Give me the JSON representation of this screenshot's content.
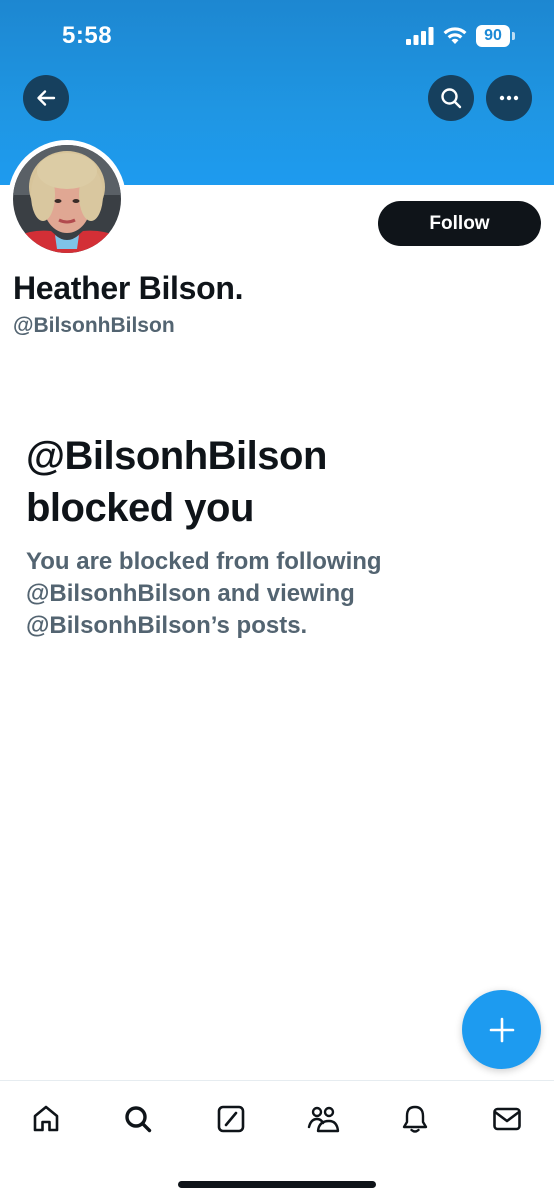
{
  "status_bar": {
    "time": "5:58",
    "battery": "90"
  },
  "header": {
    "icons": {
      "back": "arrow-left-icon",
      "search": "search-icon",
      "more": "more-horizontal-icon"
    },
    "banner_color": "#1d9bf0"
  },
  "profile": {
    "display_name": "Heather Bilson.",
    "handle": "@BilsonhBilson",
    "follow_label": "Follow"
  },
  "blocked": {
    "title_line1": "@BilsonhBilson",
    "title_line2": "blocked you",
    "desc_line1": "You are blocked from following",
    "desc_line2": "@BilsonhBilson and viewing",
    "desc_line3": "@BilsonhBilson’s posts."
  },
  "fab": {
    "icon": "plus-icon",
    "color": "#1d9bf0"
  },
  "tab_bar": {
    "tabs": [
      {
        "name": "home",
        "icon": "home-icon"
      },
      {
        "name": "explore",
        "icon": "search-icon"
      },
      {
        "name": "grok",
        "icon": "grok-icon"
      },
      {
        "name": "communities",
        "icon": "people-icon"
      },
      {
        "name": "notifications",
        "icon": "bell-icon"
      },
      {
        "name": "messages",
        "icon": "mail-icon"
      }
    ]
  }
}
